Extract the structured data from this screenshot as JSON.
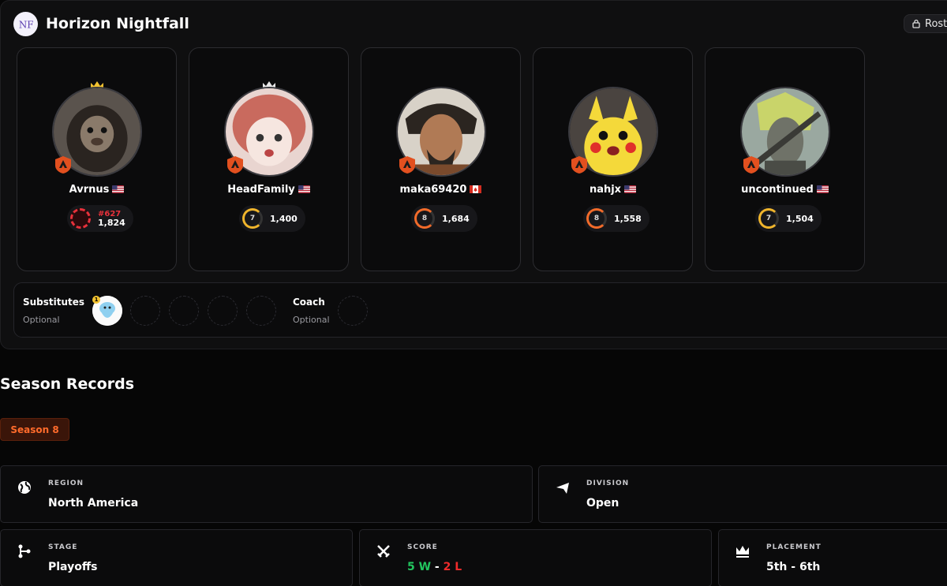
{
  "team": {
    "name": "Horizon Nightfall",
    "roster_button": "Rost",
    "logo_text": "NF"
  },
  "players": [
    {
      "name": "Avrnus",
      "flag": "us",
      "captain": true,
      "rank_number": "#627",
      "rating": "1,824",
      "level": "",
      "ring_color": "#e8313b",
      "avatar": "monkey"
    },
    {
      "name": "HeadFamily",
      "flag": "us",
      "captain": false,
      "rank_number": "",
      "rating": "1,400",
      "level": "7",
      "ring_color": "#f0b52c",
      "avatar": "anime-girl"
    },
    {
      "name": "maka69420",
      "flag": "ca",
      "captain": false,
      "rank_number": "",
      "rating": "1,684",
      "level": "8",
      "ring_color": "#f26b2a",
      "avatar": "samurai"
    },
    {
      "name": "nahjx",
      "flag": "us",
      "captain": false,
      "rank_number": "",
      "rating": "1,558",
      "level": "8",
      "ring_color": "#f26b2a",
      "avatar": "pikachu"
    },
    {
      "name": "uncontinued",
      "flag": "us",
      "captain": false,
      "rank_number": "",
      "rating": "1,504",
      "level": "7",
      "ring_color": "#f0b52c",
      "avatar": "warrior"
    }
  ],
  "substitutes": {
    "title": "Substitutes",
    "subtitle": "Optional",
    "badge": "1"
  },
  "coach": {
    "title": "Coach",
    "subtitle": "Optional"
  },
  "season": {
    "title": "Season Records",
    "tab": "Season 8",
    "region_label": "REGION",
    "region": "North America",
    "division_label": "DIVISION",
    "division": "Open",
    "stage_label": "STAGE",
    "stage": "Playoffs",
    "score_label": "SCORE",
    "score_wins": "5 W",
    "score_sep": " - ",
    "score_losses": "2 L",
    "placement_label": "PLACEMENT",
    "placement": "5th - 6th"
  },
  "colors": {
    "accent": "#ff6b2b",
    "win": "#22c55e",
    "loss": "#ef2b2b",
    "crown_captain": "#f2c230",
    "crown": "#e8e8e8"
  }
}
